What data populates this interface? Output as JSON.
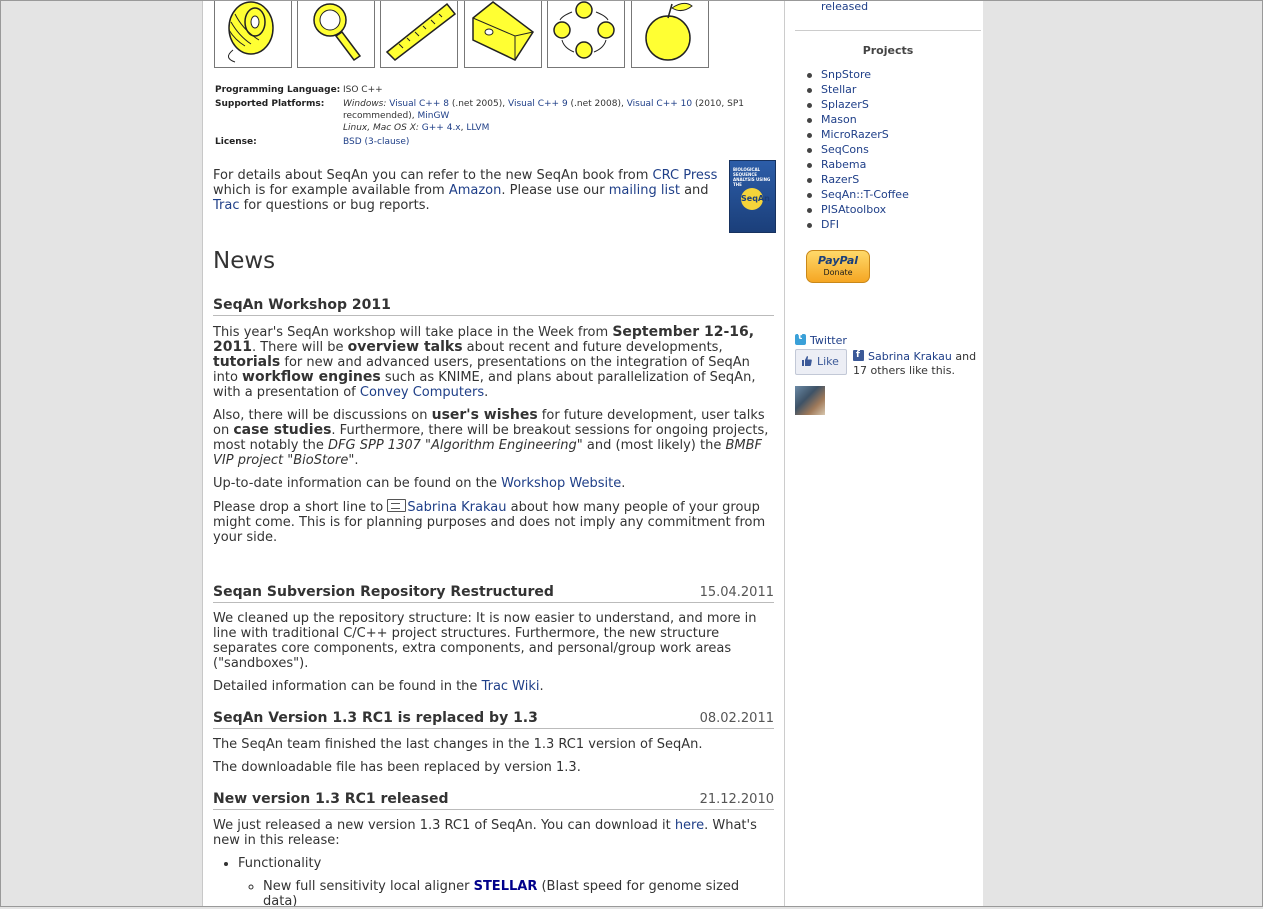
{
  "sidebar": {
    "top_link": "released",
    "projects_title": "Projects",
    "projects": [
      "SnpStore",
      "Stellar",
      "SplazerS",
      "Mason",
      "MicroRazerS",
      "SeqCons",
      "Rabema",
      "RazerS",
      "SeqAn::T-Coffee",
      "PISAtoolbox",
      "DFI"
    ],
    "paypal_brand": "PayPal",
    "paypal_label": "Donate",
    "twitter_label": "Twitter",
    "like_label": "Like",
    "fb_name": "Sabrina Krakau",
    "fb_suffix": " and 17 others like this."
  },
  "icons": [
    "thread-spool-icon",
    "magnifier-icon",
    "ruler-icon",
    "cheese-icon",
    "cycle-icon",
    "apple-icon"
  ],
  "info": {
    "lang_key": "Programming Language:",
    "lang_val": "ISO C++",
    "plat_key": "Supported Platforms:",
    "plat_win": "Windows:",
    "vc8": "Visual C++ 8",
    "vc8_note": " (.net 2005), ",
    "vc9": "Visual C++ 9",
    "vc9_note": " (.net 2008), ",
    "vc10": "Visual C++ 10",
    "vc10_note": " (2010, SP1 recommended), ",
    "mingw": "MinGW",
    "plat_unix": "Linux, Mac OS X:",
    "gcc": "G++ 4.x",
    "llvm": "LLVM",
    "lic_key": "License:",
    "lic_val": "BSD (3-clause)"
  },
  "details": {
    "t1": "For details about SeqAn you can refer to the new SeqAn book from ",
    "crc": "CRC Press",
    "t2": " which is for example available from ",
    "amazon": "Amazon",
    "t3": ". Please use our ",
    "mailing": "mailing list",
    "t4": " and ",
    "trac": "Trac",
    "t5": " for questions or bug reports.",
    "book_title": "BIOLOGICAL SEQUENCE ANALYSIS USING THE",
    "book_logo": "SeqAn"
  },
  "news_heading": "News",
  "articles": {
    "a1": {
      "title": "SeqAn Workshop 2011",
      "p1a": "This year's SeqAn workshop will take place in the Week from ",
      "p1b": "September 12-16, 2011",
      "p1c": ". There will be ",
      "p1d": "overview talks",
      "p1e": " about recent and future developments, ",
      "p1f": "tutorials",
      "p1g": " for new and advanced users, presentations on the integration of SeqAn into ",
      "p1h": "workflow engines",
      "p1i": " such as KNIME, and plans about parallelization of SeqAn, with a presentation of ",
      "p1j": "Convey Computers",
      "p1k": ".",
      "p2a": "Also, there will be discussions on ",
      "p2b": "user's wishes",
      "p2c": " for future development, user talks on ",
      "p2d": "case studies",
      "p2e": ". Furthermore, there will be breakout sessions for ongoing projects, most notably the ",
      "p2f": "DFG SPP 1307 \"Algorithm Engineering\"",
      "p2g": " and (most likely) the ",
      "p2h": "BMBF VIP project \"BioStore\"",
      "p2i": ".",
      "p3a": "Up-to-date information can be found on the ",
      "p3b": "Workshop Website",
      "p3c": ".",
      "p4a": "Please drop a short line to ",
      "p4b": "Sabrina Krakau",
      "p4c": " about how many people of your group might come. This is for planning purposes and does not imply any commitment from your side."
    },
    "a2": {
      "title": "Seqan Subversion Repository Restructured",
      "date": "15.04.2011",
      "p1": "We cleaned up the repository structure: It is now easier to understand, and more in line with traditional C/C++ project structures. Furthermore, the new structure separates core components, extra components, and personal/group work areas (\"sandboxes\").",
      "p2a": "Detailed information can be found in the ",
      "p2b": "Trac Wiki",
      "p2c": "."
    },
    "a3": {
      "title": "SeqAn Version 1.3 RC1 is replaced by 1.3",
      "date": "08.02.2011",
      "p1": "The SeqAn team finished the last changes in the 1.3 RC1 version of SeqAn.",
      "p2": "The downloadable file has been replaced by version 1.3."
    },
    "a4": {
      "title": "New version 1.3 RC1 released",
      "date": "21.12.2010",
      "p1a": "We just released a new version 1.3 RC1 of SeqAn. You can download it ",
      "p1b": "here",
      "p1c": ". What's new in this release:",
      "li1": "Functionality",
      "li2a": "New full sensitivity local aligner ",
      "li2b": "STELLAR",
      "li2c": " (Blast speed for genome sized data)"
    }
  },
  "colors": {
    "link": "#1f3f88",
    "icon_fill": "#ffff33",
    "paypal": "#f5a623"
  }
}
